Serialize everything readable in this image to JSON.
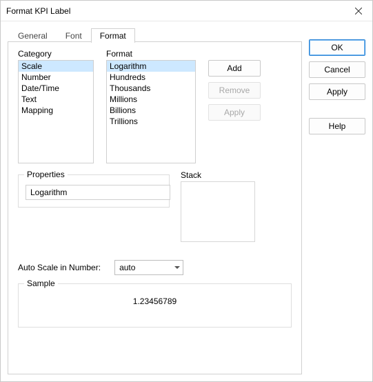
{
  "window": {
    "title": "Format KPI Label"
  },
  "tabs": {
    "general": "General",
    "font": "Font",
    "format": "Format"
  },
  "labels": {
    "category": "Category",
    "format": "Format",
    "stack": "Stack",
    "properties": "Properties",
    "auto_scale": "Auto Scale in Number:",
    "sample": "Sample"
  },
  "category_items": [
    "Scale",
    "Number",
    "Date/Time",
    "Text",
    "Mapping"
  ],
  "format_items": [
    "Logarithm",
    "Hundreds",
    "Thousands",
    "Millions",
    "Billions",
    "Trillions"
  ],
  "mid_buttons": {
    "add": "Add",
    "remove": "Remove",
    "apply": "Apply"
  },
  "properties_value": "Logarithm",
  "auto_scale_value": "auto",
  "sample_value": "1.23456789",
  "side_buttons": {
    "ok": "OK",
    "cancel": "Cancel",
    "apply": "Apply",
    "help": "Help"
  }
}
